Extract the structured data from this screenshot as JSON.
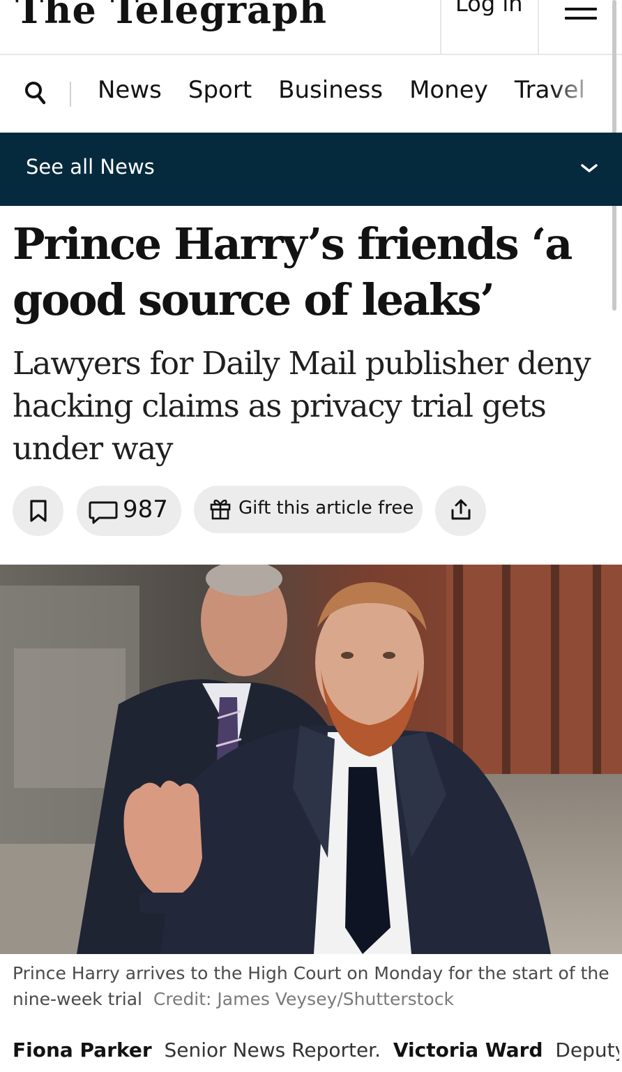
{
  "header": {
    "logo_text": "The Telegraph",
    "login_label": "Log in",
    "menu_icon": "hamburger-menu-icon"
  },
  "nav": {
    "search_icon": "search-icon",
    "items": [
      "News",
      "Sport",
      "Business",
      "Money",
      "Travel"
    ]
  },
  "section": {
    "label": "See all News",
    "toggle_icon": "chevron-down-icon",
    "background_color": "#062a3d"
  },
  "article": {
    "headline": "Prince Harry’s friends ‘a good source of leaks’",
    "standfirst": "Lawyers for Daily Mail publisher deny hacking claims as privacy trial gets under way",
    "actions": {
      "bookmark_icon": "bookmark-icon",
      "comment_icon": "comment-icon",
      "comment_count": "987",
      "gift_icon": "gift-icon",
      "gift_label": "Gift this article free",
      "share_icon": "share-icon"
    },
    "image": {
      "caption": "Prince Harry arrives to the High Court on Monday for the start of the nine-week trial",
      "credit": "Credit: James Veysey/Shutterstock"
    },
    "byline": {
      "author1_name": "Fiona Parker",
      "author1_role": "Senior News Reporter.",
      "author2_name": "Victoria Ward",
      "author2_role": "Deputy Royal Editor"
    }
  }
}
